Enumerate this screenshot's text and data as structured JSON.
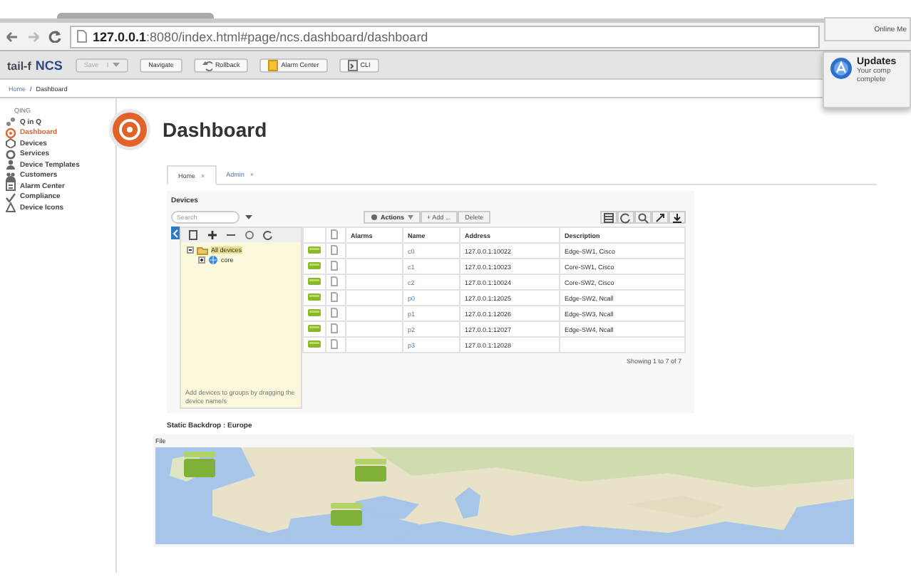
{
  "browser": {
    "url": "**127.0.0.1**:8080/index.html#page/ncs.dashboard/dashboard"
  },
  "toolbar": {
    "logo_brand": "tail-f",
    "logo_product": "NCS",
    "buttons": [
      {
        "label": "Save",
        "kind": "split",
        "disabled": true
      },
      {
        "label": "Navigate",
        "kind": "plain",
        "disabled": false
      },
      {
        "label": "Rollback",
        "kind": "rollback",
        "disabled": false
      },
      {
        "label": "Alarm Center",
        "kind": "alarm",
        "disabled": false
      },
      {
        "label": "CLI",
        "kind": "cli",
        "disabled": false
      }
    ]
  },
  "breadcrumb": [
    "Home",
    "/",
    "Dashboard"
  ],
  "notification": {
    "menu_item": "Online Me",
    "title": "Updates",
    "lines": [
      "Your comp",
      "complete"
    ]
  },
  "sidebar": {
    "heading": "QING",
    "items": [
      {
        "label": "Q in Q",
        "selected": false
      },
      {
        "label": "Dashboard",
        "selected": true
      },
      {
        "label": "Devices",
        "selected": false
      },
      {
        "label": "Services",
        "selected": false
      },
      {
        "label": "Device Templates",
        "selected": false
      },
      {
        "label": "Customers",
        "selected": false
      },
      {
        "label": "Alarm Center",
        "selected": false
      },
      {
        "label": "Compliance",
        "selected": false
      },
      {
        "label": "Device Icons",
        "selected": false
      }
    ]
  },
  "page_title": "Dashboard",
  "tabs": [
    {
      "label": "Home",
      "close": "×",
      "selected": true
    },
    {
      "label": "Admin",
      "close": "×",
      "selected": false
    }
  ],
  "devices": {
    "title": "Devices",
    "search_placeholder": "Search",
    "actions": [
      "Actions",
      "+ Add ...",
      "Delete"
    ],
    "tree": [
      {
        "label": "All devices",
        "expanded": true,
        "children": [
          {
            "label": "core",
            "expanded": false
          }
        ]
      }
    ],
    "tree_hint": "Add devices to groups by dragging the device name/s",
    "columns": [
      "Alarms",
      "Name",
      "Address",
      "Description"
    ],
    "rows": [
      {
        "name": "c0",
        "address": "127.0.0.1:10022",
        "description": "Edge-SW1, Cisco"
      },
      {
        "name": "c1",
        "address": "127.0.0.1:10023",
        "description": "Core-SW1, Cisco"
      },
      {
        "name": "c2",
        "address": "127.0.0.1:10024",
        "description": "Core-SW2, Cisco"
      },
      {
        "name": "p0",
        "address": "127.0.0.1:12025",
        "description": "Edge-SW2, Ncall"
      },
      {
        "name": "p1",
        "address": "127.0.0.1:12026",
        "description": "Edge-SW3, Ncall"
      },
      {
        "name": "p2",
        "address": "127.0.0.1:12027",
        "description": "Edge-SW4, Ncall"
      },
      {
        "name": "p3",
        "address": "127.0.0.1:12028",
        "description": ""
      }
    ],
    "footer": "Showing 1 to 7 of 7"
  },
  "backdrop": {
    "title": "Static Backdrop : Europe",
    "file_label": "File"
  }
}
